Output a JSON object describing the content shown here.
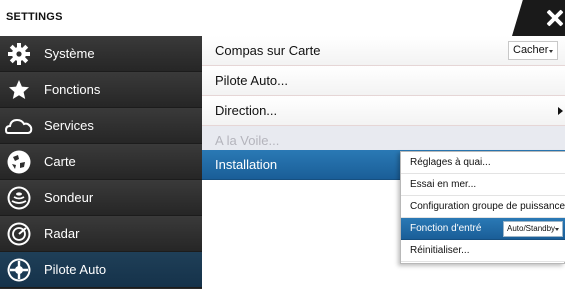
{
  "header": {
    "title": "SETTINGS"
  },
  "sidebar": {
    "items": [
      {
        "label": "Système",
        "icon": "gear-icon"
      },
      {
        "label": "Fonctions",
        "icon": "star-icon"
      },
      {
        "label": "Services",
        "icon": "cloud-icon"
      },
      {
        "label": "Carte",
        "icon": "chart-icon"
      },
      {
        "label": "Sondeur",
        "icon": "sonar-icon"
      },
      {
        "label": "Radar",
        "icon": "radar-icon"
      },
      {
        "label": "Pilote Auto",
        "icon": "autopilot-icon"
      }
    ],
    "active": "Pilote Auto"
  },
  "content": {
    "rows": [
      {
        "label": "Compas sur Carte",
        "value": "Cacher"
      },
      {
        "label": "Pilote Auto..."
      },
      {
        "label": "Direction..."
      },
      {
        "label": "A la Voile...",
        "state": "disabled"
      },
      {
        "label": "Installation",
        "state": "selected"
      }
    ]
  },
  "submenu": {
    "items": [
      {
        "label": "Réglages à quai..."
      },
      {
        "label": "Essai en mer..."
      },
      {
        "label": "Configuration groupe de puissance..."
      },
      {
        "label": "Fonction d'entré",
        "value": "Auto/Standby",
        "state": "selected"
      },
      {
        "label": "Réinitialiser..."
      }
    ]
  },
  "colors": {
    "accent": "#1f6aa8",
    "sidebar": "#2a2a2a",
    "active_sidebar": "#1a3a55"
  }
}
